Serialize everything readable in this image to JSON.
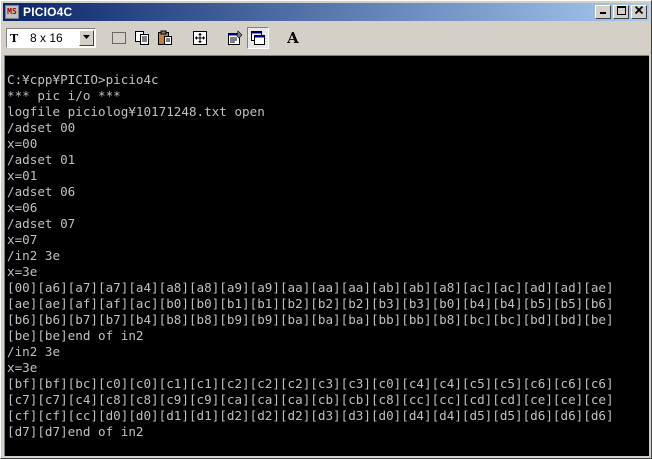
{
  "window": {
    "title": "PICIO4C",
    "icon_label": "MS"
  },
  "toolbar": {
    "font_icon": "T",
    "font_size": "8 x 16",
    "buttons": [
      "mark-icon",
      "copy-icon",
      "paste-icon",
      "fullscreen-icon",
      "properties-icon",
      "background-icon",
      "font-icon"
    ],
    "font_button_label": "A"
  },
  "terminal": {
    "lines": [
      "C:¥cpp¥PICIO>picio4c",
      "*** pic i/o ***",
      "logfile piciolog¥10171248.txt open",
      "/adset 00",
      "x=00",
      "/adset 01",
      "x=01",
      "/adset 06",
      "x=06",
      "/adset 07",
      "x=07",
      "/in2 3e",
      "x=3e",
      "[00][a6][a7][a7][a4][a8][a8][a9][a9][aa][aa][aa][ab][ab][a8][ac][ac][ad][ad][ae]",
      "[ae][ae][af][af][ac][b0][b0][b1][b1][b2][b2][b2][b3][b3][b0][b4][b4][b5][b5][b6]",
      "[b6][b6][b7][b7][b4][b8][b8][b9][b9][ba][ba][ba][bb][bb][b8][bc][bc][bd][bd][be]",
      "[be][be]end of in2",
      "/in2 3e",
      "x=3e",
      "[bf][bf][bc][c0][c0][c1][c1][c2][c2][c2][c3][c3][c0][c4][c4][c5][c5][c6][c6][c6]",
      "[c7][c7][c4][c8][c8][c9][c9][ca][ca][ca][cb][cb][c8][cc][cc][cd][cd][ce][ce][ce]",
      "[cf][cf][cc][d0][d0][d1][d1][d2][d2][d2][d3][d3][d0][d4][d4][d5][d5][d6][d6][d6]",
      "[d7][d7]end of in2"
    ]
  },
  "colors": {
    "title_gradient_start": "#0a246a",
    "title_gradient_end": "#a6caf0",
    "terminal_bg": "#000000",
    "terminal_fg": "#c0c0c0",
    "chrome": "#d4d0c8"
  }
}
